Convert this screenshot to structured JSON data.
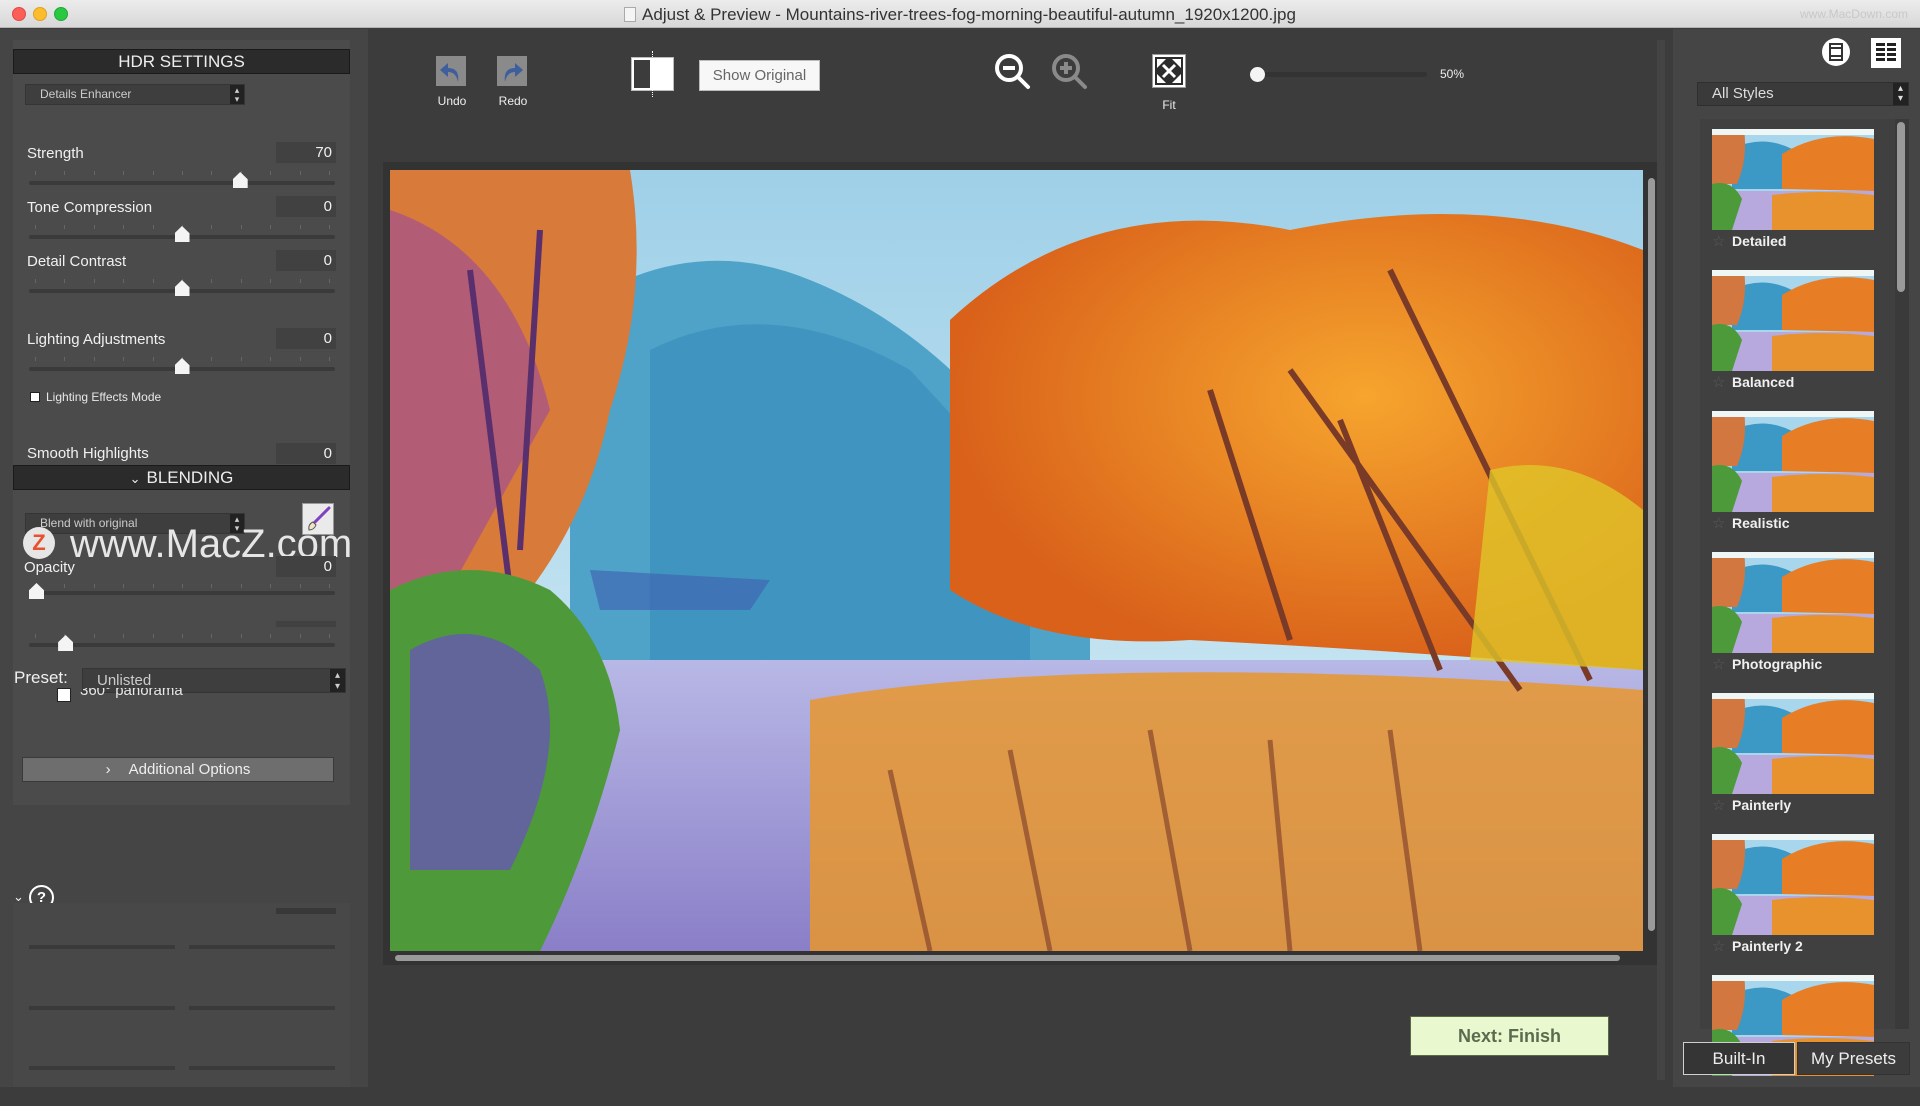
{
  "window": {
    "title": "Adjust & Preview - Mountains-river-trees-fog-morning-beautiful-autumn_1920x1200.jpg",
    "watermark": "www.MacDown.com"
  },
  "left_panel": {
    "hdr_header": "HDR SETTINGS",
    "method_select": "Details Enhancer",
    "sliders": [
      {
        "label": "Strength",
        "value": "70",
        "position": 0.7
      },
      {
        "label": "Tone Compression",
        "value": "0",
        "position": 0.5
      },
      {
        "label": "Detail Contrast",
        "value": "0",
        "position": 0.5
      },
      {
        "label": "Lighting Adjustments",
        "value": "0",
        "position": 0.5
      }
    ],
    "lighting_effects_mode": {
      "label": "Lighting Effects Mode",
      "checked": false
    },
    "smooth_highlights": {
      "label": "Smooth Highlights",
      "value": "0"
    },
    "blending_header": "BLENDING",
    "blend_select": "Blend with original",
    "opacity": {
      "label": "Opacity",
      "value": "0",
      "position": 0.0
    },
    "hidden_slider_position": 0.1,
    "preset_label": "Preset:",
    "preset_value": "Unlisted",
    "panorama": {
      "label": "360° panorama",
      "checked": false
    },
    "additional_options": "Additional Options",
    "overlay_watermark": "www.MacZ.com",
    "help_icon": "?"
  },
  "toolbar": {
    "undo": "Undo",
    "redo": "Redo",
    "show_original": "Show Original",
    "fit": "Fit",
    "zoom_value": "50%",
    "zoom_position": 0.0
  },
  "footer": {
    "next": "Next: Finish"
  },
  "right_panel": {
    "styles_filter": "All Styles",
    "styles": [
      {
        "name": "Detailed"
      },
      {
        "name": "Balanced"
      },
      {
        "name": "Realistic"
      },
      {
        "name": "Photographic"
      },
      {
        "name": "Painterly"
      },
      {
        "name": "Painterly 2"
      },
      {
        "name": ""
      }
    ],
    "tabs": [
      {
        "label": "Built-In",
        "active": true
      },
      {
        "label": "My Presets",
        "active": false
      }
    ]
  },
  "colors": {
    "next_button_bg": "#eaf8cf",
    "accent_undo": "#3e5f9c"
  }
}
